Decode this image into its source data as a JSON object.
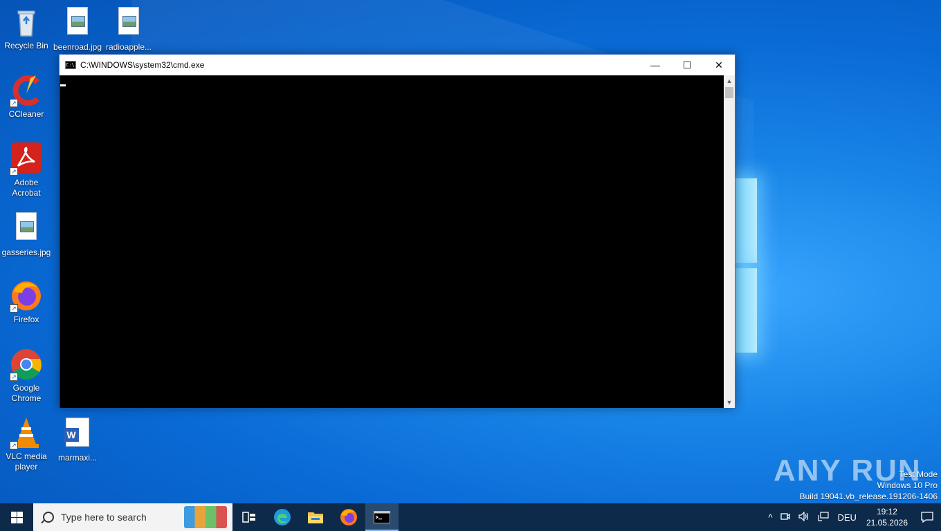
{
  "desktop": {
    "icons": [
      {
        "label": "Recycle Bin"
      },
      {
        "label": "beenroad.jpg"
      },
      {
        "label": "radioapple..."
      },
      {
        "label": "CCleaner"
      },
      {
        "label": "Adobe Acrobat"
      },
      {
        "label": "gasseries.jpg"
      },
      {
        "label": "Firefox"
      },
      {
        "label": "Google Chrome"
      },
      {
        "label": "VLC media player"
      },
      {
        "label": "marmaxi..."
      }
    ]
  },
  "cmd_window": {
    "title": "C:\\WINDOWS\\system32\\cmd.exe",
    "icon_text": "C:\\",
    "minimize": "—",
    "maximize": "☐",
    "close": "✕",
    "scroll_up": "▲",
    "scroll_down": "▼"
  },
  "watermark": {
    "brand": "ANY RUN",
    "line1": "Test Mode",
    "line2": "Windows 10 Pro",
    "line3": "Build 19041.vb_release.191206-1406"
  },
  "taskbar": {
    "search_placeholder": "Type here to search",
    "tray_chevron": "^",
    "language": "DEU",
    "time": "19:12",
    "date": "21.05.2026"
  }
}
